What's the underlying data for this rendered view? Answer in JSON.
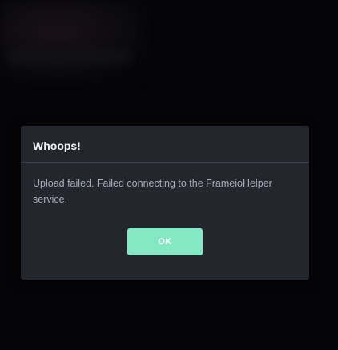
{
  "dialog": {
    "title": "Whoops!",
    "message": "Upload failed. Failed connecting to the FrameioHelper service.",
    "ok_label": "OK"
  },
  "colors": {
    "backdrop": "#050508",
    "dialog_bg": "#23262d",
    "title_text": "#f1f2f4",
    "body_text": "#a9adb5",
    "accent_button": "#84e8c4"
  }
}
